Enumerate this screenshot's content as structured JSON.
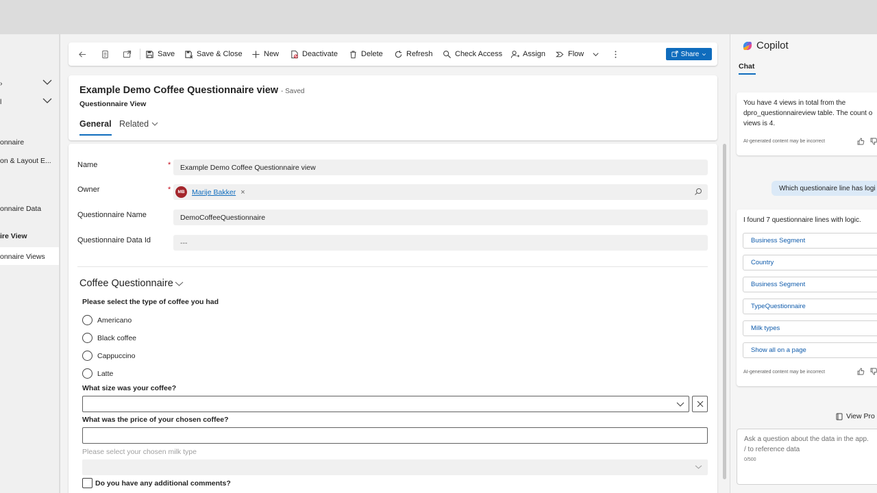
{
  "left_nav": {
    "items": [
      {
        "label": "onnaire"
      },
      {
        "label": "on & Layout E..."
      },
      {
        "label": "onnaire Data"
      },
      {
        "label": "ire View"
      },
      {
        "label": "onnaire Views"
      }
    ]
  },
  "toolbar": {
    "save": "Save",
    "save_close": "Save & Close",
    "new": "New",
    "deactivate": "Deactivate",
    "delete": "Delete",
    "refresh": "Refresh",
    "check_access": "Check Access",
    "assign": "Assign",
    "flow": "Flow",
    "share": "Share"
  },
  "record": {
    "title": "Example Demo Coffee Questionnaire view",
    "status": "- Saved",
    "entity": "Questionnaire View"
  },
  "tabs": {
    "general": "General",
    "related": "Related"
  },
  "fields": {
    "name_label": "Name",
    "name_value": "Example Demo Coffee Questionnaire view",
    "owner_label": "Owner",
    "owner_initials": "MB",
    "owner_value": "Marije Bakker",
    "owner_remove": "×",
    "qname_label": "Questionnaire Name",
    "qname_value": "DemoCoffeeQuestionnaire",
    "qdata_label": "Questionnaire Data Id",
    "qdata_value": "---",
    "required_mark": "*"
  },
  "questionnaire": {
    "section_title": "Coffee Questionnaire",
    "q1": "Please select the type of coffee you had",
    "q1_options": [
      "Americano",
      "Black coffee",
      "Cappuccino",
      "Latte"
    ],
    "q2": "What size was your coffee?",
    "q3": "What was the price of your chosen coffee?",
    "q4": "Please select your chosen milk type",
    "q5": "Do you have any additional comments?"
  },
  "copilot": {
    "title": "Copilot",
    "tab": "Chat",
    "msg1_lines": [
      "You have 4 views in total from the",
      "dpro_questionnaireview table. The count o",
      "views is 4."
    ],
    "disclaimer": "AI-generated content may be incorrect",
    "user_msg": "Which questionaire line has logi",
    "msg2": "I found 7 questionnaire lines with logic.",
    "links": [
      "Business Segment",
      "Country",
      "Business Segment",
      "TypeQuestionnaire",
      "Milk types",
      "Show all on a page"
    ],
    "view_prompts": "View Pro",
    "input_placeholder_1": "Ask a question about the data in the app.",
    "input_placeholder_2": "/ to reference data",
    "counter": "0/500"
  },
  "colors": {
    "accent": "#0f6cbd",
    "required": "#c50f1f",
    "avatar": "#a4262c"
  }
}
